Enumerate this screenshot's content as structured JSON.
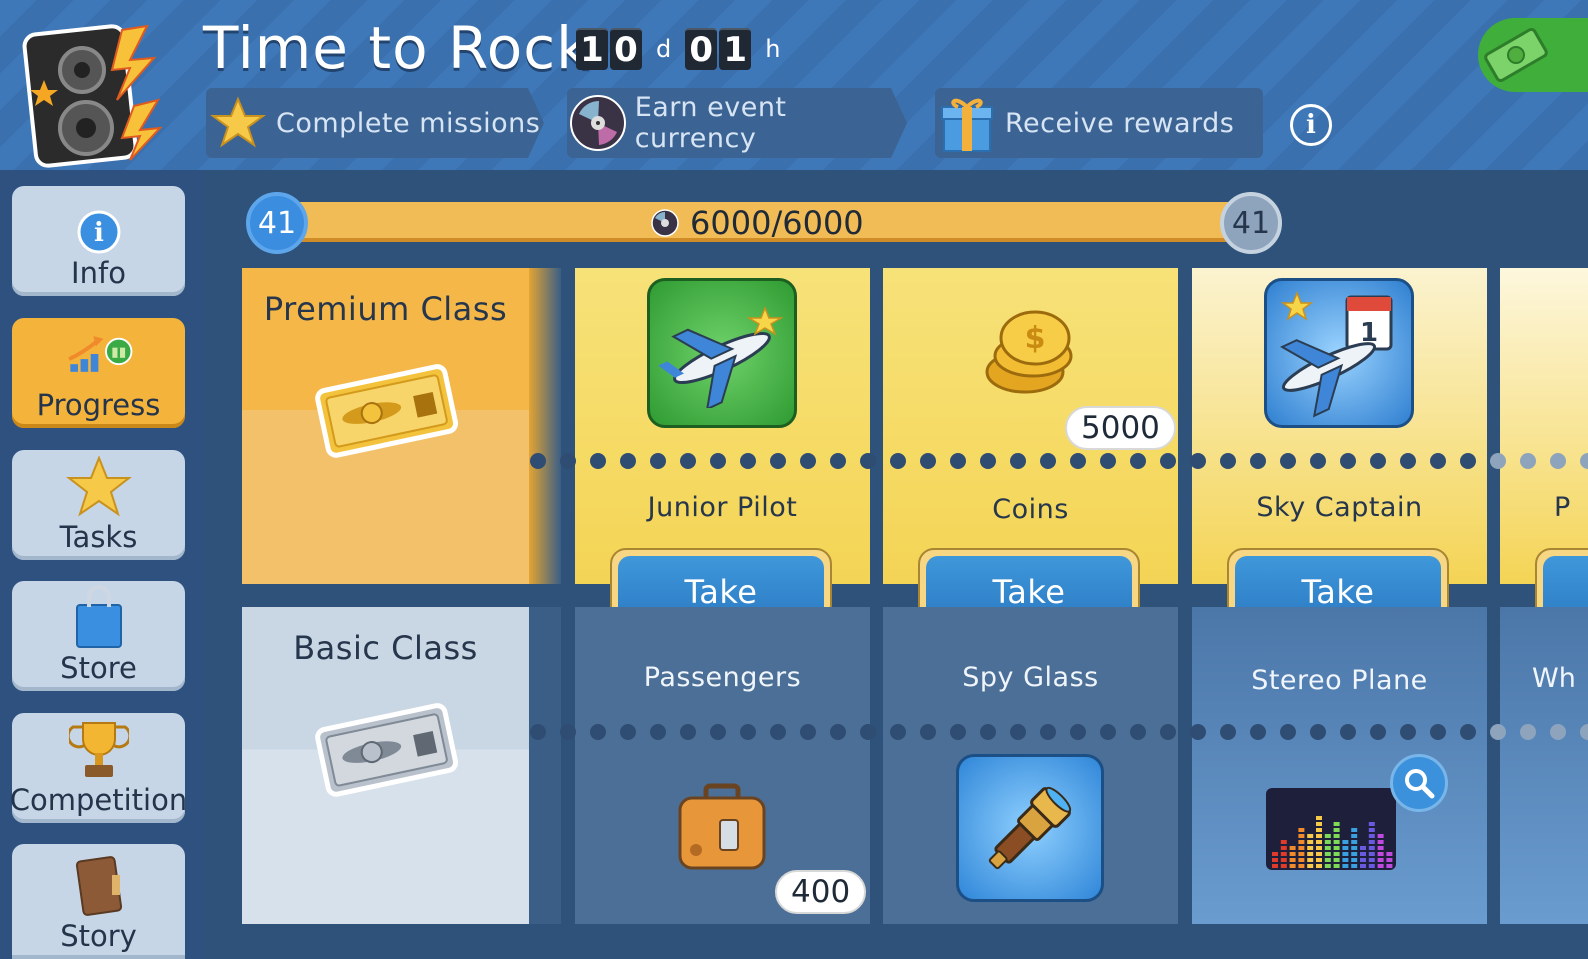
{
  "event": {
    "title": "Time to Rock",
    "timer": {
      "days": "10",
      "days_unit": "d",
      "hours": "01",
      "hours_unit": "h"
    }
  },
  "steps": [
    {
      "label": "Complete missions",
      "icon": "star-icon"
    },
    {
      "label": "Earn event currency",
      "icon": "vinyl-disc-icon"
    },
    {
      "label": "Receive rewards",
      "icon": "gift-icon"
    }
  ],
  "sidebar": {
    "items": [
      {
        "label": "Info",
        "icon": "info-icon"
      },
      {
        "label": "Progress",
        "icon": "progress-chart-icon",
        "active": true
      },
      {
        "label": "Tasks",
        "icon": "star-icon"
      },
      {
        "label": "Store",
        "icon": "shopping-bag-icon"
      },
      {
        "label": "Competition",
        "icon": "trophy-icon"
      },
      {
        "label": "Story",
        "icon": "book-icon"
      }
    ]
  },
  "progress": {
    "level_current": "41",
    "level_next": "41",
    "text": "6000/6000",
    "fraction": 1.0
  },
  "classes": {
    "premium": "Premium Class",
    "basic": "Basic Class"
  },
  "rewards": [
    {
      "premium": {
        "name": "Junior Pilot",
        "icon": "jet-plane-icon",
        "button": "Take"
      },
      "basic": {
        "name": "Passengers",
        "icon": "suitcase-icon",
        "quantity": "400"
      }
    },
    {
      "premium": {
        "name": "Coins",
        "icon": "coins-icon",
        "quantity": "5000",
        "button": "Take"
      },
      "basic": {
        "name": "Spy Glass",
        "icon": "spyglass-icon"
      }
    },
    {
      "premium": {
        "name": "Sky Captain",
        "icon": "jet-calendar-icon",
        "button": "Take"
      },
      "basic": {
        "name": "Stereo Plane",
        "icon": "equalizer-plane-icon"
      }
    }
  ],
  "peek": {
    "premium_letter": "P",
    "basic_letters": "Wh"
  },
  "colors": {
    "header_blue": "#3f78b8",
    "accent_orange": "#f4b33b",
    "take_blue": "#2a78c2",
    "premium_yellow": "#f4d455"
  }
}
